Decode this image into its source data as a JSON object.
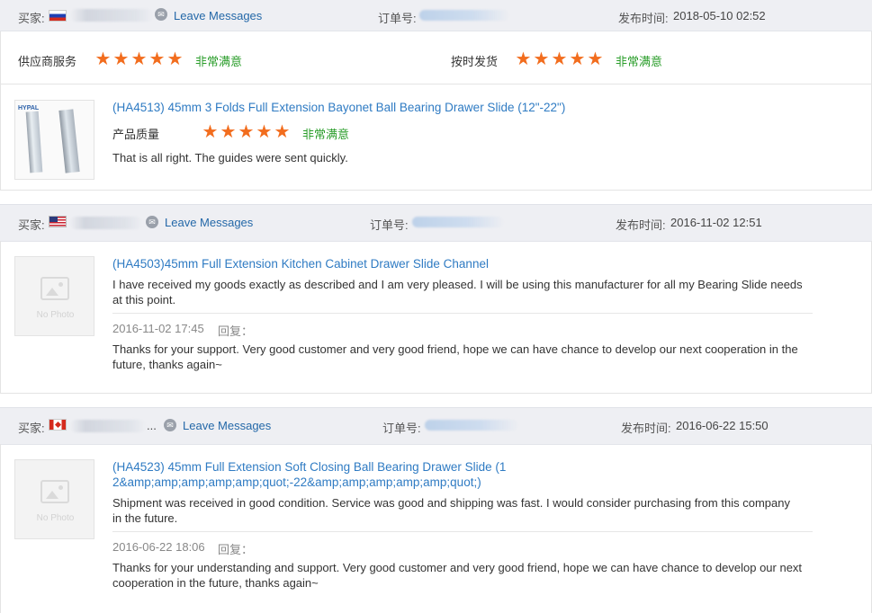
{
  "reviews": [
    {
      "buyer_label": "买家:",
      "leave_messages": "Leave Messages",
      "order_label": "订单号:",
      "date_label": "发布时间:",
      "date_value": "2018-05-10 02:52",
      "supplier_service_label": "供应商服务",
      "supplier_service_rating": "非常满意",
      "on_time_label": "按时发货",
      "on_time_rating": "非常满意",
      "product_title": "(HA4513) 45mm 3 Folds Full Extension Bayonet Ball Bearing Drawer Slide (12\"-22\")",
      "product_quality_label": "产品质量",
      "product_quality_rating": "非常满意",
      "comment": "That is all right. The guides were sent quickly.",
      "stars": 5,
      "thumb_brand": "HYPAL"
    },
    {
      "buyer_label": "买家:",
      "leave_messages": "Leave Messages",
      "order_label": "订单号:",
      "date_label": "发布时间:",
      "date_value": "2016-11-02 12:51",
      "product_title": "(HA4503)45mm Full Extension Kitchen Cabinet Drawer Slide Channel",
      "comment": "I have received my goods exactly as described and I am very pleased. I will be using this manufacturer for all my Bearing Slide needs at this point.",
      "reply_date": "2016-11-02 17:45",
      "reply_label": "回复：",
      "reply_text": "Thanks for your support. Very good customer and very good friend, hope we can have chance to develop our next cooperation in the future, thanks again~",
      "no_photo": "No Photo"
    },
    {
      "buyer_label": "买家:",
      "buyer_ellipsis": "...",
      "leave_messages": "Leave Messages",
      "order_label": "订单号:",
      "date_label": "发布时间:",
      "date_value": "2016-06-22 15:50",
      "product_title": "(HA4523) 45mm Full Extension Soft Closing Ball Bearing Drawer Slide (12&amp;amp;amp;amp;amp;quot;-22&amp;amp;amp;amp;amp;quot;)",
      "comment": "Shipment was received in good condition. Service was good and shipping was fast. I would consider purchasing from this company in the future.",
      "reply_date": "2016-06-22 18:06",
      "reply_label": "回复：",
      "reply_text": "Thanks for your understanding and support. Very good customer and very good friend, hope we can have chance to develop our next cooperation in the future, thanks again~",
      "no_photo": "No Photo"
    }
  ],
  "colors": {
    "star": "#f26d1e",
    "rating_green": "#2a9d2a",
    "link_blue": "#2f7bc3",
    "header_bg": "#eeeff3"
  },
  "icons": [
    "flag-russia-icon",
    "flag-usa-icon",
    "flag-canada-icon",
    "message-icon",
    "star-icon",
    "no-photo-icon"
  ]
}
